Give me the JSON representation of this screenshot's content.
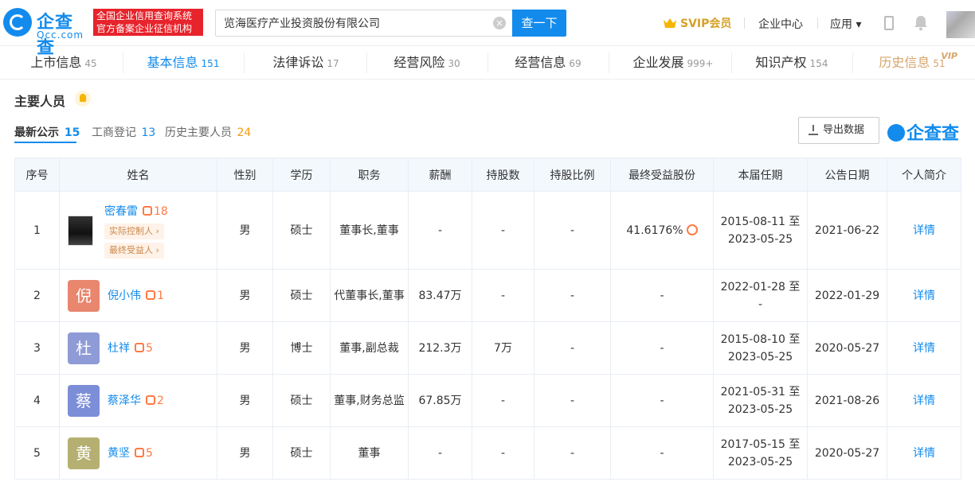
{
  "header": {
    "logo_name": "企查查",
    "logo_sub": "Qcc.com",
    "slogan_line1": "全国企业信用查询系统",
    "slogan_line2": "官方备案企业征信机构",
    "search_value": "览海医疗产业投资股份有限公司",
    "search_button": "查一下",
    "svip_label": "SVIP会员",
    "enterprise_center": "企业中心",
    "apps_label": "应用 ▾"
  },
  "tabs": [
    {
      "label": "上市信息",
      "count": "45"
    },
    {
      "label": "基本信息",
      "count": "151"
    },
    {
      "label": "法律诉讼",
      "count": "17"
    },
    {
      "label": "经营风险",
      "count": "30"
    },
    {
      "label": "经营信息",
      "count": "69"
    },
    {
      "label": "企业发展",
      "count": "999+"
    },
    {
      "label": "知识产权",
      "count": "154"
    },
    {
      "label": "历史信息",
      "count": "51",
      "vip": "VIP"
    }
  ],
  "section": {
    "title": "主要人员",
    "subtabs": [
      {
        "label": "最新公示",
        "count": "15"
      },
      {
        "label": "工商登记",
        "count": "13"
      },
      {
        "label": "历史主要人员",
        "count": "24"
      }
    ],
    "export_label": "导出数据",
    "brand_mark": "企查查"
  },
  "table": {
    "headers": [
      "序号",
      "姓名",
      "性别",
      "学历",
      "职务",
      "薪酬",
      "持股数",
      "持股比例",
      "最终受益股份",
      "本届任期",
      "公告日期",
      "个人简介"
    ],
    "rows": [
      {
        "no": "1",
        "name": "密春雷",
        "rel": "18",
        "avatar": "",
        "avatar_color": "",
        "tags": [
          "实际控制人 ›",
          "最终受益人 ›"
        ],
        "gender": "男",
        "edu": "硕士",
        "title": "董事长,董事",
        "pay": "-",
        "shares": "-",
        "ratio": "-",
        "benefit": "41.6176%",
        "term1": "2015-08-11 至",
        "term2": "2023-05-25",
        "date": "2021-06-22",
        "detail": "详情"
      },
      {
        "no": "2",
        "name": "倪小伟",
        "rel": "1",
        "avatar": "倪",
        "avatar_color": "#e8866e",
        "tags": [],
        "gender": "男",
        "edu": "硕士",
        "title": "代董事长,董事",
        "pay": "83.47万",
        "shares": "-",
        "ratio": "-",
        "benefit": "-",
        "term1": "2022-01-28 至",
        "term2": "-",
        "date": "2022-01-29",
        "detail": "详情"
      },
      {
        "no": "3",
        "name": "杜祥",
        "rel": "5",
        "avatar": "杜",
        "avatar_color": "#8f9bd6",
        "tags": [],
        "gender": "男",
        "edu": "博士",
        "title": "董事,副总裁",
        "pay": "212.3万",
        "shares": "7万",
        "ratio": "-",
        "benefit": "-",
        "term1": "2015-08-10 至",
        "term2": "2023-05-25",
        "date": "2020-05-27",
        "detail": "详情"
      },
      {
        "no": "4",
        "name": "蔡泽华",
        "rel": "2",
        "avatar": "蔡",
        "avatar_color": "#7c8ed8",
        "tags": [],
        "gender": "男",
        "edu": "硕士",
        "title": "董事,财务总监",
        "pay": "67.85万",
        "shares": "-",
        "ratio": "-",
        "benefit": "-",
        "term1": "2021-05-31 至",
        "term2": "2023-05-25",
        "date": "2021-08-26",
        "detail": "详情"
      },
      {
        "no": "5",
        "name": "黄坚",
        "rel": "5",
        "avatar": "黄",
        "avatar_color": "#b5b071",
        "tags": [],
        "gender": "男",
        "edu": "硕士",
        "title": "董事",
        "pay": "-",
        "shares": "-",
        "ratio": "-",
        "benefit": "-",
        "term1": "2017-05-15 至",
        "term2": "2023-05-25",
        "date": "2020-05-27",
        "detail": "详情"
      }
    ]
  },
  "colors": {
    "primary": "#128bed",
    "orange": "#ff7a45",
    "gold": "#d7a56b"
  }
}
